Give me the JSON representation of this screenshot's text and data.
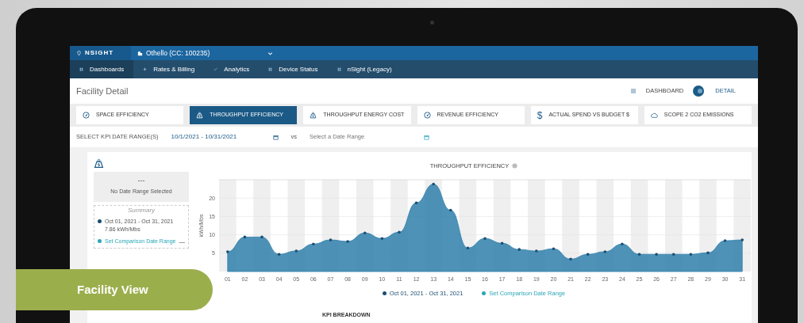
{
  "top_bar": {
    "brand": "NSIGHT",
    "facility": "Othello (CC: 100235)"
  },
  "nav": [
    {
      "label": "Dashboards",
      "kind": "grid",
      "selected": true
    },
    {
      "label": "Rates & Billing",
      "kind": "plus",
      "selected": false
    },
    {
      "label": "Analytics",
      "kind": "check",
      "selected": false
    },
    {
      "label": "Device Status",
      "kind": "grid",
      "selected": false
    },
    {
      "label": "nSight (Legacy)",
      "kind": "grid",
      "selected": false
    }
  ],
  "page_title": "Facility Detail",
  "view_toggle": [
    {
      "label": "DASHBOARD",
      "selected": false
    },
    {
      "label": "DETAIL",
      "selected": true
    }
  ],
  "kpi_tabs": [
    {
      "label": "SPACE EFFICIENCY",
      "kind": "gauge",
      "selected": false
    },
    {
      "label": "THROUGHPUT EFFICIENCY",
      "kind": "weight",
      "selected": true
    },
    {
      "label": "THROUGHPUT ENERGY COST",
      "kind": "weight",
      "selected": false
    },
    {
      "label": "REVENUE EFFICIENCY",
      "kind": "gauge",
      "selected": false
    },
    {
      "label": "ACTUAL SPEND VS BUDGET $",
      "kind": "symbol",
      "symbol": "$",
      "selected": false
    },
    {
      "label": "SCOPE 2 CO2 EMISSIONS",
      "kind": "cloud",
      "selected": false
    }
  ],
  "date_range": {
    "label": "SELECT KPI DATE RANGE(S)",
    "value": "10/1/2021 - 10/31/2021",
    "separator": "vs",
    "placeholder": "Select a Date Range"
  },
  "summary_panel": {
    "dash": "---",
    "comparison_note": "No Date Range Selected",
    "title": "Summary",
    "items": [
      {
        "label": "Oct 01, 2021 - Oct 31, 2021",
        "value": "7.86 kWh/Mbs",
        "color": "#1b4f72"
      },
      {
        "label": "Set Comparison Date Range",
        "action": "—",
        "color": "#2aa6b8"
      }
    ]
  },
  "chart": {
    "chart_data": {
      "type": "area",
      "title": "THROUGHPUT EFFICIENCY",
      "ylabel": "kWh/Mbs",
      "categories": [
        "01",
        "02",
        "03",
        "04",
        "05",
        "06",
        "07",
        "08",
        "09",
        "10",
        "11",
        "12",
        "13",
        "14",
        "15",
        "16",
        "17",
        "18",
        "19",
        "20",
        "21",
        "22",
        "23",
        "24",
        "25",
        "26",
        "27",
        "28",
        "29",
        "30",
        "31"
      ],
      "series": [
        {
          "name": "Oct 01, 2021 - Oct 31, 2021",
          "color": "#2f7fab",
          "values": [
            5.4,
            9.4,
            9.4,
            4.7,
            5.6,
            7.5,
            8.6,
            8.2,
            10.5,
            9.0,
            10.7,
            18.7,
            23.8,
            16.7,
            6.4,
            9.0,
            7.7,
            6.0,
            5.6,
            6.2,
            3.4,
            4.7,
            5.4,
            7.5,
            4.7,
            4.7,
            4.7,
            4.7,
            5.1,
            8.4,
            8.6
          ]
        }
      ],
      "ylim": [
        0,
        25
      ],
      "grid": true,
      "yticks": [
        5,
        10,
        15,
        20
      ]
    },
    "comparison_legend": {
      "label": "Set Comparison Date Range",
      "color": "#2aa6b8"
    }
  },
  "section_heading": "KPI BREAKDOWN",
  "banner": "Facility View"
}
